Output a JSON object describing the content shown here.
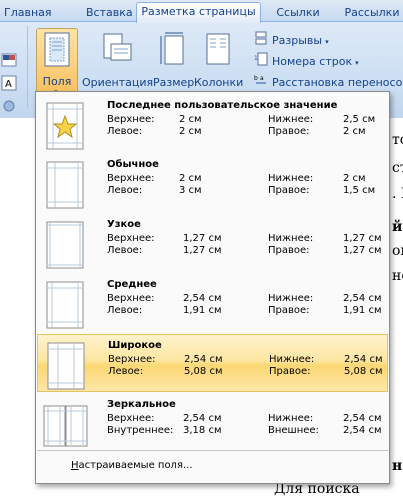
{
  "ribbon_tabs": [
    "Главная",
    "Вставка",
    "Разметка страницы",
    "Ссылки",
    "Рассылки"
  ],
  "ribbon_buttons": {
    "margins": "Поля",
    "orientation": "Ориентация",
    "size": "Размер",
    "columns": "Колонки"
  },
  "ribbon_small": {
    "breaks": "Разрывы",
    "line_numbers": "Номера строк",
    "hyphenation": "Расстановка переносов"
  },
  "margins_menu": {
    "options": [
      {
        "name": "Последнее пользовательское значение",
        "row1_left_label": "Верхнее:",
        "row1_left_value": "2 см",
        "row1_right_label": "Нижнее:",
        "row1_right_value": "2,5 см",
        "row2_left_label": "Левое:",
        "row2_left_value": "2 см",
        "row2_right_label": "Правое:",
        "row2_right_value": "2 см",
        "icon": "star-page-icon"
      },
      {
        "name": "Обычное",
        "row1_left_label": "Верхнее:",
        "row1_left_value": "2 см",
        "row1_right_label": "Нижнее:",
        "row1_right_value": "2 см",
        "row2_left_label": "Левое:",
        "row2_left_value": "3 см",
        "row2_right_label": "Правое:",
        "row2_right_value": "1,5 см",
        "icon": "page-normal-icon"
      },
      {
        "name": "Узкое",
        "row1_left_label": "Верхнее:",
        "row1_left_value": "1,27 см",
        "row1_right_label": "Нижнее:",
        "row1_right_value": "1,27 см",
        "row2_left_label": "Левое:",
        "row2_left_value": "1,27 см",
        "row2_right_label": "Правое:",
        "row2_right_value": "1,27 см",
        "icon": "page-narrow-icon"
      },
      {
        "name": "Среднее",
        "row1_left_label": "Верхнее:",
        "row1_left_value": "2,54 см",
        "row1_right_label": "Нижнее:",
        "row1_right_value": "2,54 см",
        "row2_left_label": "Левое:",
        "row2_left_value": "1,91 см",
        "row2_right_label": "Правое:",
        "row2_right_value": "1,91 см",
        "icon": "page-moderate-icon"
      },
      {
        "name": "Широкое",
        "row1_left_label": "Верхнее:",
        "row1_left_value": "2,54 см",
        "row1_right_label": "Нижнее:",
        "row1_right_value": "2,54 см",
        "row2_left_label": "Левое:",
        "row2_left_value": "5,08 см",
        "row2_right_label": "Правое:",
        "row2_right_value": "5,08 см",
        "icon": "page-wide-icon"
      },
      {
        "name": "Зеркальное",
        "row1_left_label": "Верхнее:",
        "row1_left_value": "2,54 см",
        "row1_right_label": "Нижнее:",
        "row1_right_value": "2,54 см",
        "row2_left_label": "Внутреннее:",
        "row2_left_value": "3,18 см",
        "row2_right_label": "Внешнее:",
        "row2_right_value": "2,54 см",
        "icon": "page-mirrored-icon"
      }
    ],
    "highlighted_option": "Широкое",
    "custom_margins_label_mnemonic": "Н",
    "custom_margins_label_rest": "астраиваемые поля..."
  },
  "document_fragments": [
    "то",
    "ст",
    ". Р",
    "й в",
    "ом",
    "но",
    "на",
    "Для     поиска"
  ]
}
